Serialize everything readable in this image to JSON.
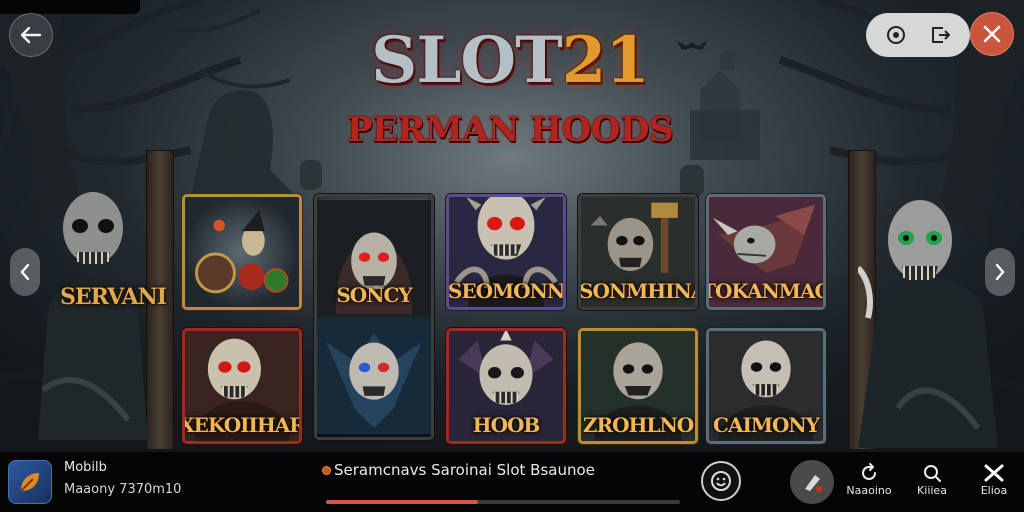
{
  "game": {
    "title_part1": "SLOT",
    "title_part2": "21",
    "subtitle": "PERMAN HOODS",
    "side_label_left": "SERVANI"
  },
  "tiles": [
    {
      "label": ""
    },
    {
      "label": "SONCY"
    },
    {
      "label": "SEOMONN"
    },
    {
      "label": "ISONMHINA"
    },
    {
      "label": "TOKANMAO"
    },
    {
      "label": "XEKOIIHAR"
    },
    {
      "label": ""
    },
    {
      "label": "HOOB"
    },
    {
      "label": "ZROHLNO"
    },
    {
      "label": "CAIMONY"
    }
  ],
  "bottom_bar": {
    "app_name": "Mobilb",
    "app_meta": "Maaony 7370m10",
    "now_playing": "Seramcnavs Saroinai Slot Bsaunoe",
    "progress_fraction": 0.43,
    "actions": [
      {
        "label": "Naaoino",
        "icon": "refresh-icon"
      },
      {
        "label": "Kiiiea",
        "icon": "search-icon"
      },
      {
        "label": "Elioa",
        "icon": "cross-icon"
      }
    ]
  },
  "colors": {
    "accent": "#c9563c",
    "title_steel": "#b5bfc6",
    "title_gold": "#e39a2a",
    "subtitle_red": "#b3241e",
    "label_gold": "#efb755"
  },
  "icons": {
    "back": "arrow-left-icon",
    "target": "target-icon",
    "exit": "exit-icon",
    "close": "close-icon",
    "prev": "chevron-left-icon",
    "next": "chevron-right-icon"
  }
}
